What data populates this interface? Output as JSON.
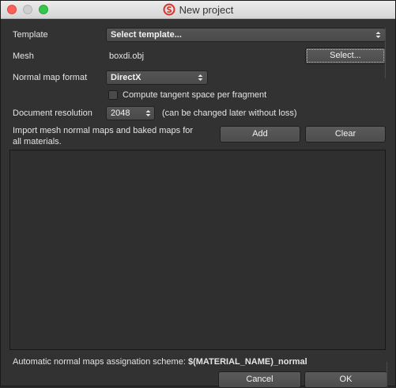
{
  "window": {
    "title": "New project"
  },
  "template": {
    "label": "Template",
    "value": "Select template..."
  },
  "mesh": {
    "label": "Mesh",
    "file": "boxdi.obj",
    "select_label": "Select..."
  },
  "normal_map": {
    "label": "Normal map format",
    "value": "DirectX"
  },
  "tangent": {
    "label": "Compute tangent space per fragment",
    "checked": false
  },
  "resolution": {
    "label": "Document resolution",
    "value": "2048",
    "note": "(can be changed later without loss)"
  },
  "import": {
    "line1": "Import mesh normal maps and baked maps for",
    "line2": "all materials.",
    "add_label": "Add",
    "clear_label": "Clear"
  },
  "scheme": {
    "label": "Automatic normal maps assignation scheme:",
    "value": "$(MATERIAL_NAME)_normal"
  },
  "footer": {
    "cancel_label": "Cancel",
    "ok_label": "OK"
  },
  "colors": {
    "background": "#323232",
    "logo_red": "#d9312b"
  }
}
